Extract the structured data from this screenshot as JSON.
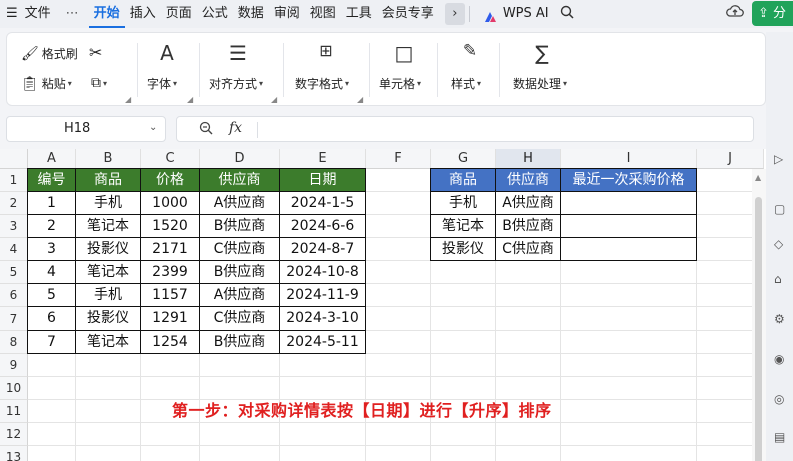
{
  "menu": {
    "hamburger_icon": "hamburger-icon",
    "file": "文件",
    "more": "⋯",
    "tabs": [
      "开始",
      "插入",
      "页面",
      "公式",
      "数据",
      "审阅",
      "视图",
      "工具",
      "会员专享"
    ],
    "active_tab": "开始",
    "expand_arrow": "›",
    "wps_ai": "WPS AI",
    "share": "分"
  },
  "ribbon": {
    "format_painter": "格式刷",
    "paste": "粘贴",
    "font": "字体",
    "align": "对齐方式",
    "number_format": "数字格式",
    "cell": "单元格",
    "style": "样式",
    "data_process": "数据处理"
  },
  "formula_bar": {
    "name_box": "H18",
    "fx": "fx",
    "value": ""
  },
  "sheet": {
    "columns": [
      "A",
      "B",
      "C",
      "D",
      "E",
      "F",
      "G",
      "H",
      "I",
      "J"
    ],
    "selected_column": "H",
    "rows": [
      "1",
      "2",
      "3",
      "4",
      "5",
      "6",
      "7",
      "8",
      "9",
      "10",
      "11",
      "12",
      "13"
    ],
    "table1": {
      "headers": [
        "编号",
        "商品",
        "价格",
        "供应商",
        "日期"
      ],
      "rows": [
        [
          "1",
          "手机",
          "1000",
          "A供应商",
          "2024-1-5"
        ],
        [
          "2",
          "笔记本",
          "1520",
          "B供应商",
          "2024-6-6"
        ],
        [
          "3",
          "投影仪",
          "2171",
          "C供应商",
          "2024-8-7"
        ],
        [
          "4",
          "笔记本",
          "2399",
          "B供应商",
          "2024-10-8"
        ],
        [
          "5",
          "手机",
          "1157",
          "A供应商",
          "2024-11-9"
        ],
        [
          "6",
          "投影仪",
          "1291",
          "C供应商",
          "2024-3-10"
        ],
        [
          "7",
          "笔记本",
          "1254",
          "B供应商",
          "2024-5-11"
        ]
      ]
    },
    "table2": {
      "headers": [
        "商品",
        "供应商",
        "最近一次采购价格"
      ],
      "rows": [
        [
          "手机",
          "A供应商",
          ""
        ],
        [
          "笔记本",
          "B供应商",
          ""
        ],
        [
          "投影仪",
          "C供应商",
          ""
        ]
      ]
    },
    "note": "第一步：对采购详情表按【日期】进行【升序】排序"
  },
  "colors": {
    "green_header": "#3c7c2c",
    "blue_header": "#4472c4",
    "note_red": "#e02020",
    "accent": "#1a6fe0",
    "share_green": "#20a35a"
  }
}
